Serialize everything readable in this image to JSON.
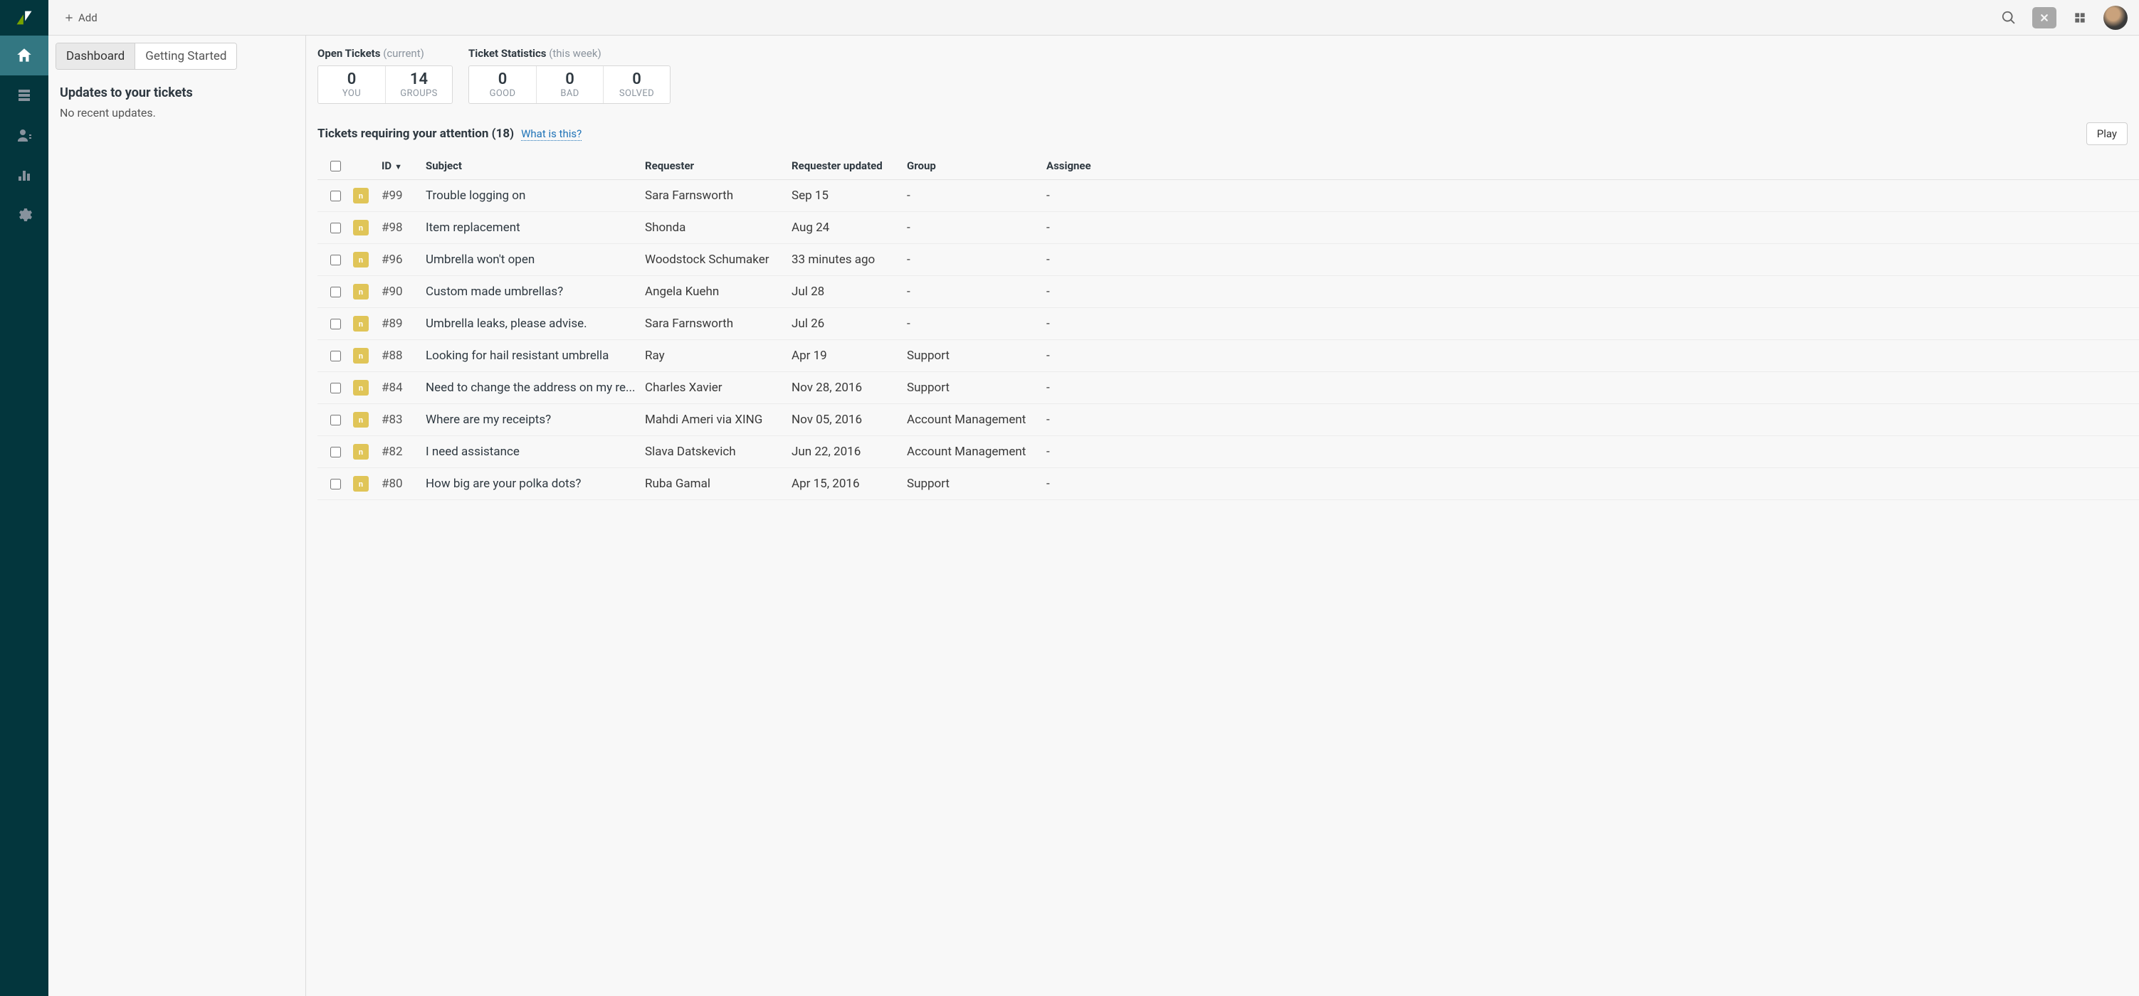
{
  "topbar": {
    "add_label": "Add"
  },
  "tabs": {
    "dashboard": "Dashboard",
    "getting_started": "Getting Started"
  },
  "updates": {
    "heading": "Updates to your tickets",
    "text": "No recent updates."
  },
  "stats": {
    "open": {
      "title_strong": "Open Tickets",
      "title_muted": "(current)",
      "items": [
        {
          "value": "0",
          "label": "YOU"
        },
        {
          "value": "14",
          "label": "GROUPS"
        }
      ]
    },
    "tstat": {
      "title_strong": "Ticket Statistics",
      "title_muted": "(this week)",
      "items": [
        {
          "value": "0",
          "label": "GOOD"
        },
        {
          "value": "0",
          "label": "BAD"
        },
        {
          "value": "0",
          "label": "SOLVED"
        }
      ]
    }
  },
  "attention": {
    "title": "Tickets requiring your attention",
    "count": "(18)",
    "whatis": "What is this?",
    "play": "Play"
  },
  "table": {
    "headers": {
      "id": "ID",
      "subject": "Subject",
      "requester": "Requester",
      "updated": "Requester updated",
      "group": "Group",
      "assignee": "Assignee"
    },
    "rows": [
      {
        "id": "#99",
        "subject": "Trouble logging on",
        "requester": "Sara Farnsworth",
        "updated": "Sep 15",
        "group": "-",
        "assignee": "-"
      },
      {
        "id": "#98",
        "subject": "Item replacement",
        "requester": "Shonda",
        "updated": "Aug 24",
        "group": "-",
        "assignee": "-"
      },
      {
        "id": "#96",
        "subject": "Umbrella won't open",
        "requester": "Woodstock Schumaker",
        "updated": "33 minutes ago",
        "group": "-",
        "assignee": "-"
      },
      {
        "id": "#90",
        "subject": "Custom made umbrellas?",
        "requester": "Angela Kuehn",
        "updated": "Jul 28",
        "group": "-",
        "assignee": "-"
      },
      {
        "id": "#89",
        "subject": "Umbrella leaks, please advise.",
        "requester": "Sara Farnsworth",
        "updated": "Jul 26",
        "group": "-",
        "assignee": "-"
      },
      {
        "id": "#88",
        "subject": "Looking for hail resistant umbrella",
        "requester": "Ray",
        "updated": "Apr 19",
        "group": "Support",
        "assignee": "-"
      },
      {
        "id": "#84",
        "subject": "Need to change the address on my re...",
        "requester": "Charles Xavier",
        "updated": "Nov 28, 2016",
        "group": "Support",
        "assignee": "-"
      },
      {
        "id": "#83",
        "subject": "Where are my receipts?",
        "requester": "Mahdi Ameri via XING",
        "updated": "Nov 05, 2016",
        "group": "Account Management",
        "assignee": "-"
      },
      {
        "id": "#82",
        "subject": "I need assistance",
        "requester": "Slava Datskevich",
        "updated": "Jun 22, 2016",
        "group": "Account Management",
        "assignee": "-"
      },
      {
        "id": "#80",
        "subject": "How big are your polka dots?",
        "requester": "Ruba Gamal",
        "updated": "Apr 15, 2016",
        "group": "Support",
        "assignee": "-"
      }
    ]
  },
  "status_chip_text": "n"
}
